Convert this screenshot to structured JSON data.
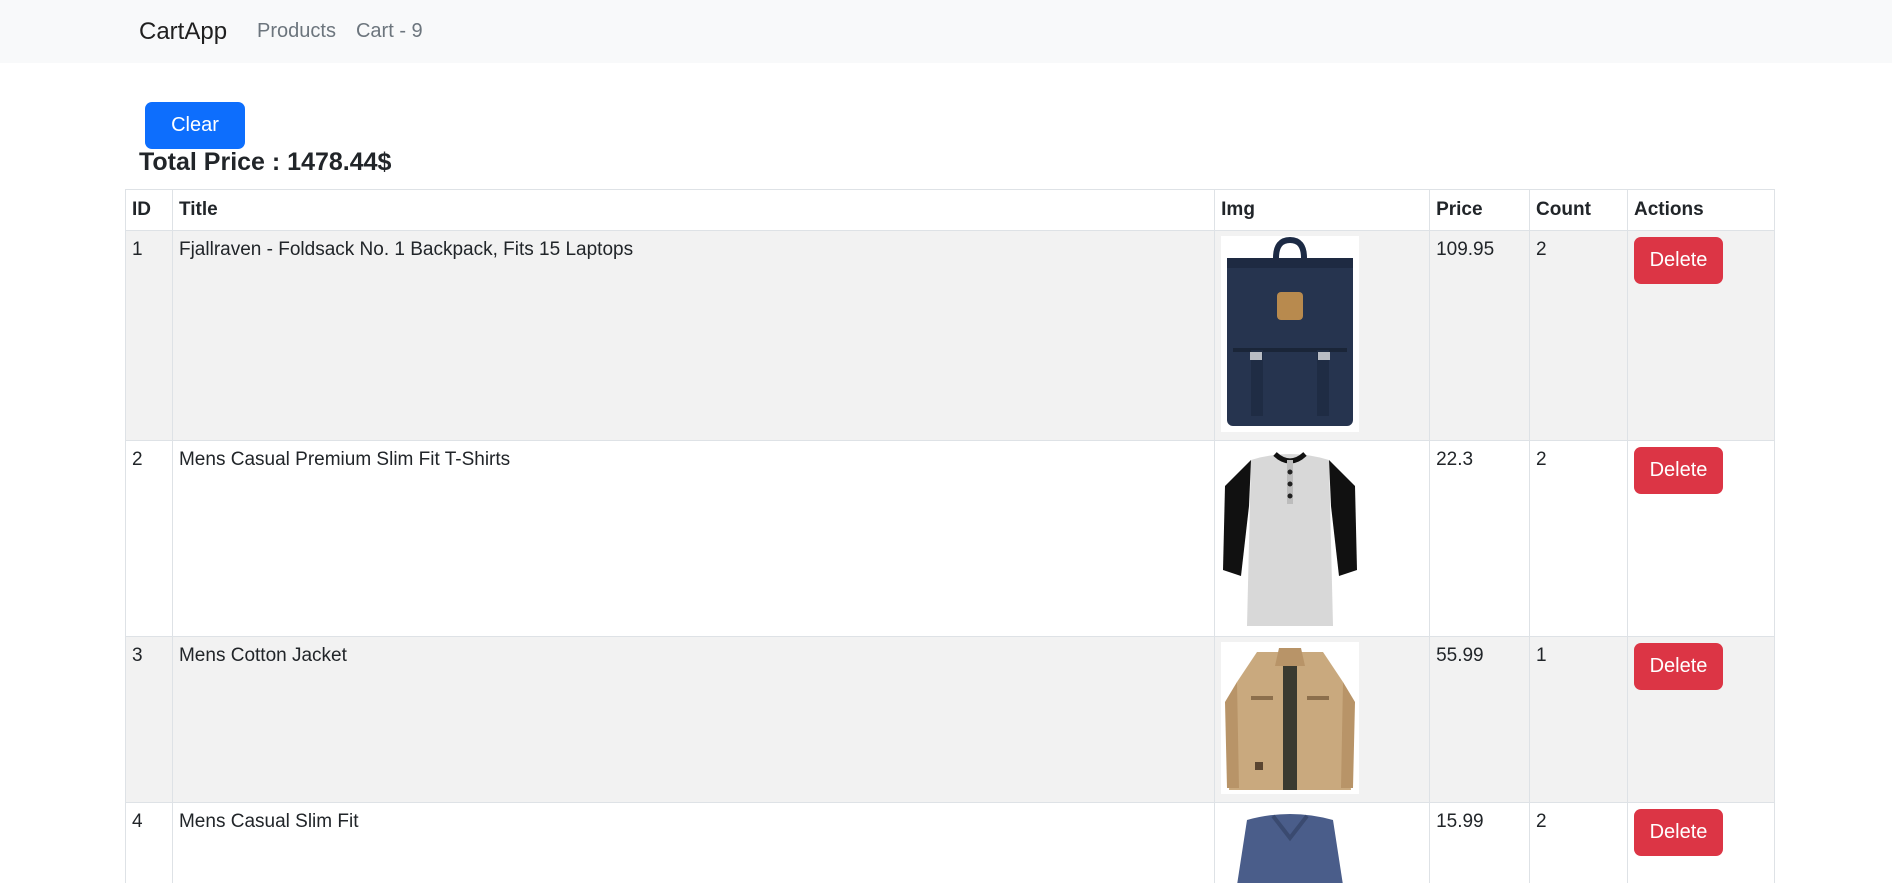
{
  "navbar": {
    "brand": "CartApp",
    "links": [
      "Products",
      "Cart - 9"
    ]
  },
  "toolbar": {
    "clear_label": "Clear"
  },
  "summary": {
    "total_text": "Total Price : 1478.44$"
  },
  "table": {
    "headers": [
      "ID",
      "Title",
      "Img",
      "Price",
      "Count",
      "Actions"
    ],
    "rows": [
      {
        "id": "1",
        "title": "Fjallraven - Foldsack No. 1 Backpack, Fits 15 Laptops",
        "image": "navy-backpack",
        "price": "109.95",
        "count": "2",
        "action": "Delete"
      },
      {
        "id": "2",
        "title": "Mens Casual Premium Slim Fit T-Shirts",
        "image": "raglan-tshirt",
        "price": "22.3",
        "count": "2",
        "action": "Delete"
      },
      {
        "id": "3",
        "title": "Mens Cotton Jacket",
        "image": "khaki-jacket",
        "price": "55.99",
        "count": "1",
        "action": "Delete"
      },
      {
        "id": "4",
        "title": "Mens Casual Slim Fit",
        "image": "blue-longsleeve",
        "price": "15.99",
        "count": "2",
        "action": "Delete"
      }
    ]
  },
  "colors": {
    "primary": "#0d6efd",
    "danger": "#dc3545",
    "navbar_bg": "#f8f9fa",
    "stripe": "#f2f2f2"
  }
}
